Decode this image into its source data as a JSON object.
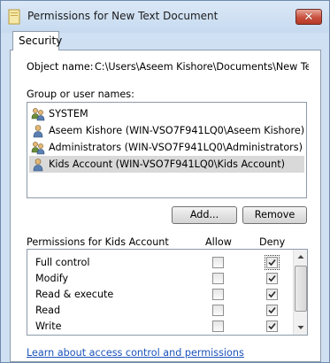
{
  "window": {
    "title": "Permissions for New Text Document",
    "close_label": "✕"
  },
  "tabs": [
    {
      "label": "Security"
    }
  ],
  "object_name": {
    "label": "Object name:",
    "value": "C:\\Users\\Aseem Kishore\\Documents\\New Text Do"
  },
  "group_section": {
    "label": "Group or user names:",
    "items": [
      {
        "label": "SYSTEM",
        "icon": "users-group-icon",
        "selected": false
      },
      {
        "label": "Aseem Kishore (WIN-VSO7F941LQ0\\Aseem Kishore)",
        "icon": "user-icon",
        "selected": false
      },
      {
        "label": "Administrators (WIN-VSO7F941LQ0\\Administrators)",
        "icon": "users-group-icon",
        "selected": false
      },
      {
        "label": "Kids Account (WIN-VSO7F941LQ0\\Kids Account)",
        "icon": "user-icon",
        "selected": true
      }
    ]
  },
  "buttons": {
    "add": "Add...",
    "remove": "Remove"
  },
  "permissions": {
    "header": "Permissions for Kids Account",
    "allow_header": "Allow",
    "deny_header": "Deny",
    "rows": [
      {
        "name": "Full control",
        "allow": false,
        "deny": true
      },
      {
        "name": "Modify",
        "allow": false,
        "deny": true
      },
      {
        "name": "Read & execute",
        "allow": false,
        "deny": true
      },
      {
        "name": "Read",
        "allow": false,
        "deny": true
      },
      {
        "name": "Write",
        "allow": false,
        "deny": true
      }
    ]
  },
  "link_text": "Learn about access control and permissions"
}
